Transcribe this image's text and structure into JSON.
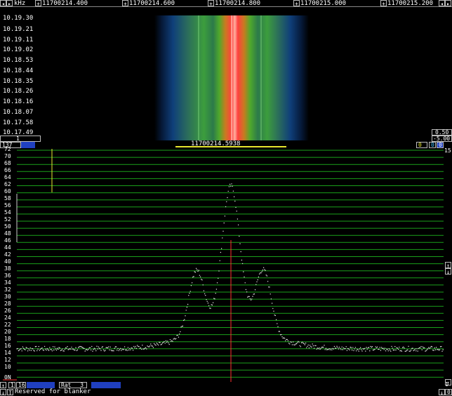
{
  "freq_axis": {
    "unit": "kHz",
    "ticks": [
      "11700214.400",
      "11700214.600",
      "11700214.800",
      "11700215.000",
      "11700215.200"
    ]
  },
  "waterfall": {
    "times": [
      "10.19.30",
      "10.19.21",
      "10.19.11",
      "10.19.02",
      "10.18.53",
      "10.18.44",
      "10.18.35",
      "10.18.26",
      "10.18.16",
      "10.18.07",
      "10.17.58",
      "10.17.49"
    ],
    "scale_top": "0.50",
    "scale_bottom": "-5.00",
    "bottom_button": "1"
  },
  "status_bar": {
    "left_value": "137",
    "center_freq": "11700214.5938",
    "right_a": "0",
    "right_b": "0",
    "right_c": "0",
    "right_num": "15"
  },
  "spectrum": {
    "y_labels": [
      "72",
      "70",
      "68",
      "66",
      "64",
      "62",
      "60",
      "58",
      "56",
      "54",
      "52",
      "50",
      "48",
      "46",
      "44",
      "42",
      "40",
      "38",
      "36",
      "34",
      "32",
      "30",
      "28",
      "26",
      "24",
      "22",
      "20",
      "18",
      "16",
      "14",
      "12",
      "10"
    ],
    "bottom_label": "0N",
    "marker_freq": "11700214.5938"
  },
  "bottom_bar": {
    "row1": [
      "1",
      "16",
      "",
      "Rat",
      "3",
      "",
      ""
    ],
    "rat_label": "Rat",
    "rat_value": "3",
    "box_a": "1",
    "box_b": "16",
    "row2_label": "Reserved for blanker",
    "right_top": "1",
    "right_bottom": "0"
  },
  "colors": {
    "grid": "#1aa01a",
    "marker": "#ff3030",
    "yellow": "#e6e62e",
    "blue": "#2040c0"
  }
}
